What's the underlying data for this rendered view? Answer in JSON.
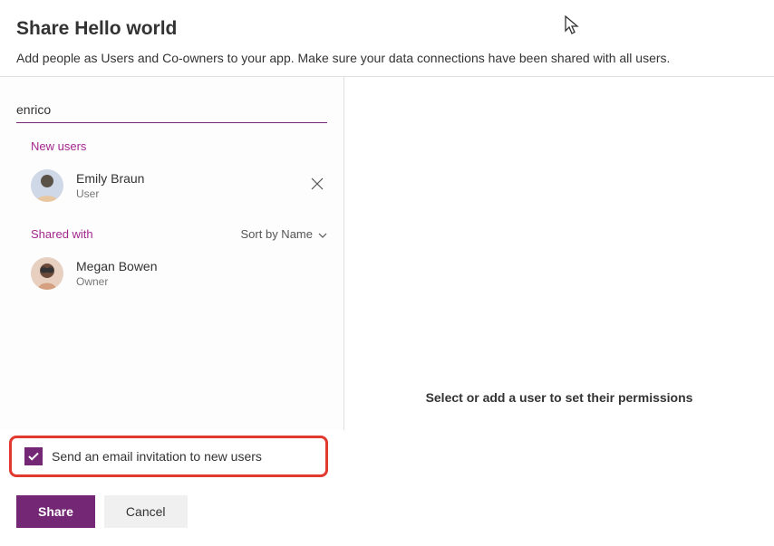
{
  "header": {
    "title": "Share Hello world",
    "subtitle": "Add people as Users and Co-owners to your app. Make sure your data connections have been shared with all users."
  },
  "search": {
    "value": "enrico"
  },
  "sections": {
    "new_users_label": "New users",
    "shared_with_label": "Shared with",
    "sort_label": "Sort by Name"
  },
  "new_users": [
    {
      "name": "Emily Braun",
      "role": "User"
    }
  ],
  "shared_with": [
    {
      "name": "Megan Bowen",
      "role": "Owner"
    }
  ],
  "email_invite": {
    "checked": true,
    "label": "Send an email invitation to new users"
  },
  "right_panel": {
    "message": "Select or add a user to set their permissions"
  },
  "footer": {
    "share": "Share",
    "cancel": "Cancel"
  }
}
